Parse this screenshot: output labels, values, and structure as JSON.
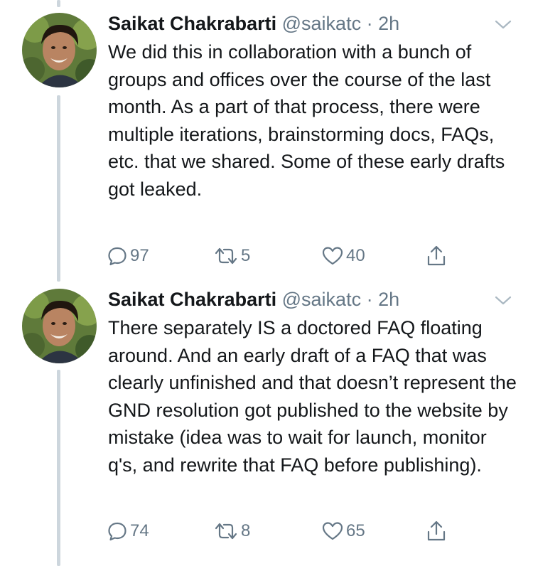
{
  "tweets": [
    {
      "name": "Saikat Chakrabarti",
      "handle": "@saikatc",
      "separator": "·",
      "time": "2h",
      "text": "We did this in collaboration with a bunch of groups and offices over the course of the last month. As a part of that process, there were multiple iterations, brainstorming docs, FAQs, etc. that we shared. Some of these early drafts got leaked.",
      "replies": "97",
      "retweets": "5",
      "likes": "40"
    },
    {
      "name": "Saikat Chakrabarti",
      "handle": "@saikatc",
      "separator": "·",
      "time": "2h",
      "text": "There separately IS a doctored FAQ floating around. And an early draft of a FAQ that was clearly unfinished and that doesn’t represent the GND resolution got published to the website by mistake (idea was to wait for launch, monitor q's, and rewrite that FAQ before publishing).",
      "replies": "74",
      "retweets": "8",
      "likes": "65"
    }
  ],
  "colors": {
    "text": "#14171a",
    "secondary": "#657786",
    "thread_line": "#cdd6dd"
  },
  "icons": [
    "reply-icon",
    "retweet-icon",
    "like-icon",
    "share-icon",
    "chevron-down-icon"
  ]
}
